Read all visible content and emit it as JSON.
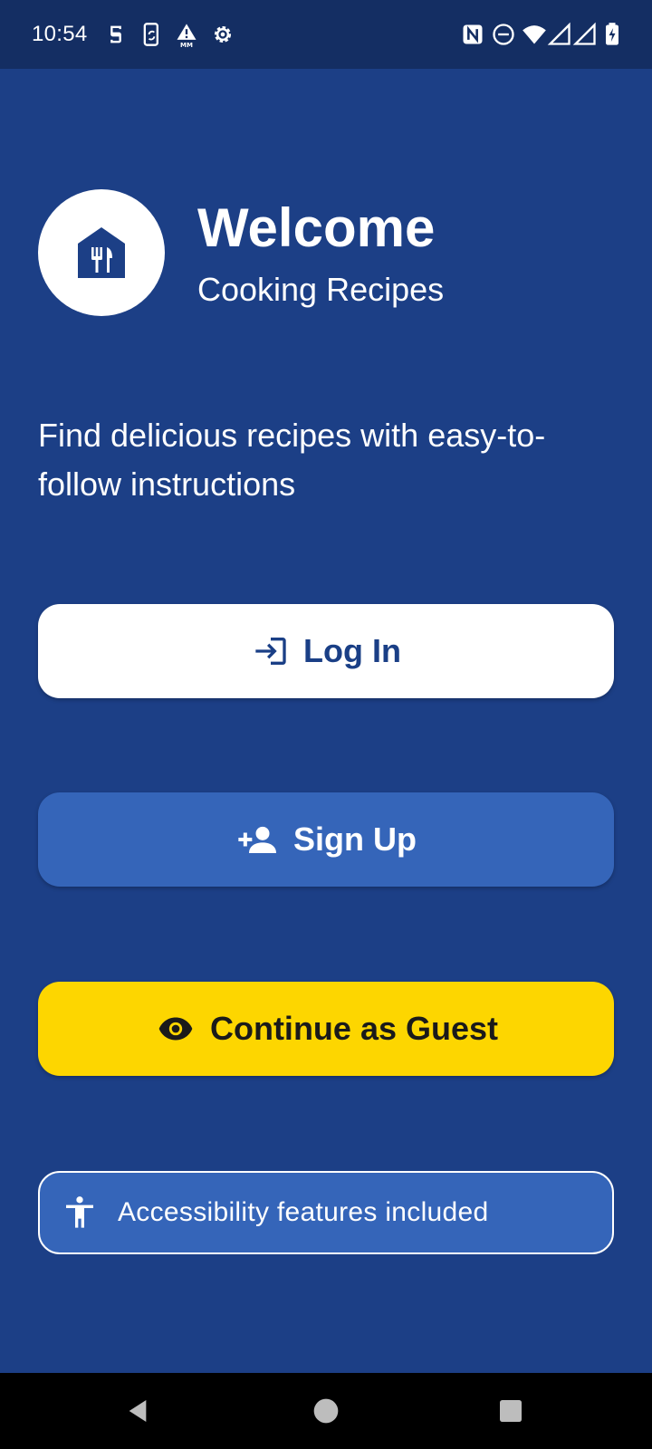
{
  "status_bar": {
    "time": "10:54",
    "left_icons": [
      "s-app-icon",
      "phone-sync-icon",
      "mm-alert-icon",
      "settings-gear-icon"
    ],
    "right_icons": [
      "nfc-icon",
      "do-not-disturb-icon",
      "wifi-icon",
      "signal-icon",
      "signal-icon",
      "battery-charging-icon"
    ]
  },
  "header": {
    "logo_icon": "house-fork-knife-icon",
    "title": "Welcome",
    "subtitle": "Cooking Recipes"
  },
  "tagline": "Find delicious recipes with easy-to-follow instructions",
  "buttons": {
    "login": {
      "label": "Log In",
      "icon": "login-icon"
    },
    "signup": {
      "label": "Sign Up",
      "icon": "person-add-icon"
    },
    "guest": {
      "label": "Continue as Guest",
      "icon": "eye-icon"
    }
  },
  "accessibility": {
    "label": "Accessibility features included",
    "icon": "accessibility-person-icon"
  },
  "nav_bar": {
    "buttons": [
      "back-icon",
      "home-icon",
      "recents-icon"
    ]
  },
  "colors": {
    "background": "#1c3f86",
    "status_bar": "#142e63",
    "primary_button": "#ffffff",
    "secondary_button": "#3565b9",
    "guest_button": "#fdd600",
    "text_on_dark": "#ffffff"
  }
}
